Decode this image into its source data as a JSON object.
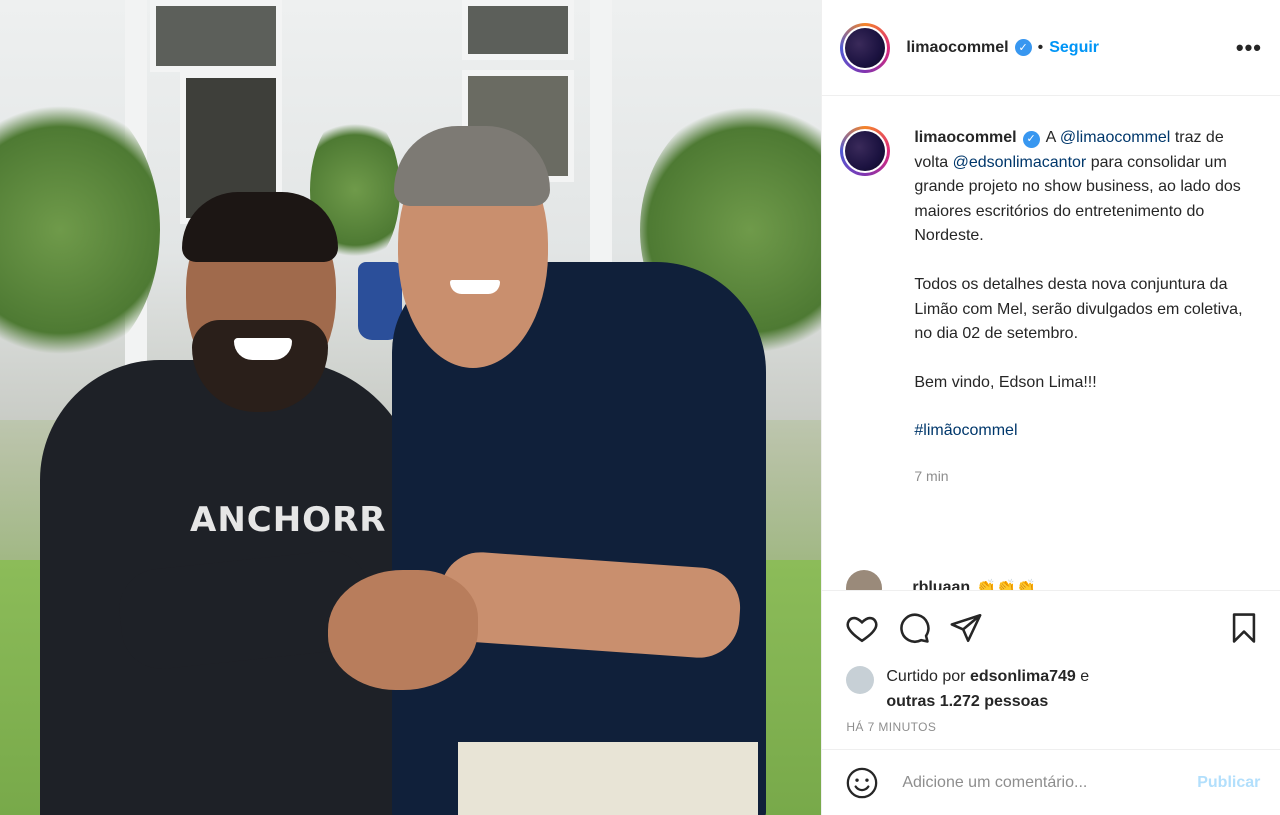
{
  "header": {
    "username": "limaocommel",
    "separator": "•",
    "follow_label": "Seguir",
    "more_label": "•••"
  },
  "caption": {
    "username": "limaocommel",
    "intro_word": "A",
    "mention1": "@limaocommel",
    "text1_mid": "traz de volta",
    "mention2": "@edsonlimacantor",
    "text1_end": "para consolidar um grande projeto no show business, ao lado dos maiores escritórios do entretenimento do Nordeste.",
    "para2": "Todos os detalhes desta nova conjuntura da Limão com Mel, serão divulgados em coletiva, no dia 02 de setembro.",
    "para3": "Bem vindo, Edson Lima!!!",
    "hashtag": "#limãocommel",
    "time": "7 min"
  },
  "comment_peek": {
    "username": "rbluaan",
    "emojis": "👏👏👏"
  },
  "likes": {
    "prefix": "Curtido por",
    "user": "edsonlima749",
    "and": "e",
    "others": "outras 1.272 pessoas"
  },
  "ago": "HÁ 7 MINUTOS",
  "add_comment": {
    "placeholder": "Adicione um comentário...",
    "publish_label": "Publicar"
  },
  "photo": {
    "shirt_text": "ANCHORR"
  },
  "colors": {
    "link": "#00376b",
    "follow": "#0095f6",
    "publish_disabled": "#b2dffc",
    "verified": "#3897f0"
  },
  "icons": [
    "verified-icon",
    "more-icon",
    "heart-icon",
    "comment-icon",
    "share-icon",
    "bookmark-icon",
    "emoji-icon"
  ]
}
